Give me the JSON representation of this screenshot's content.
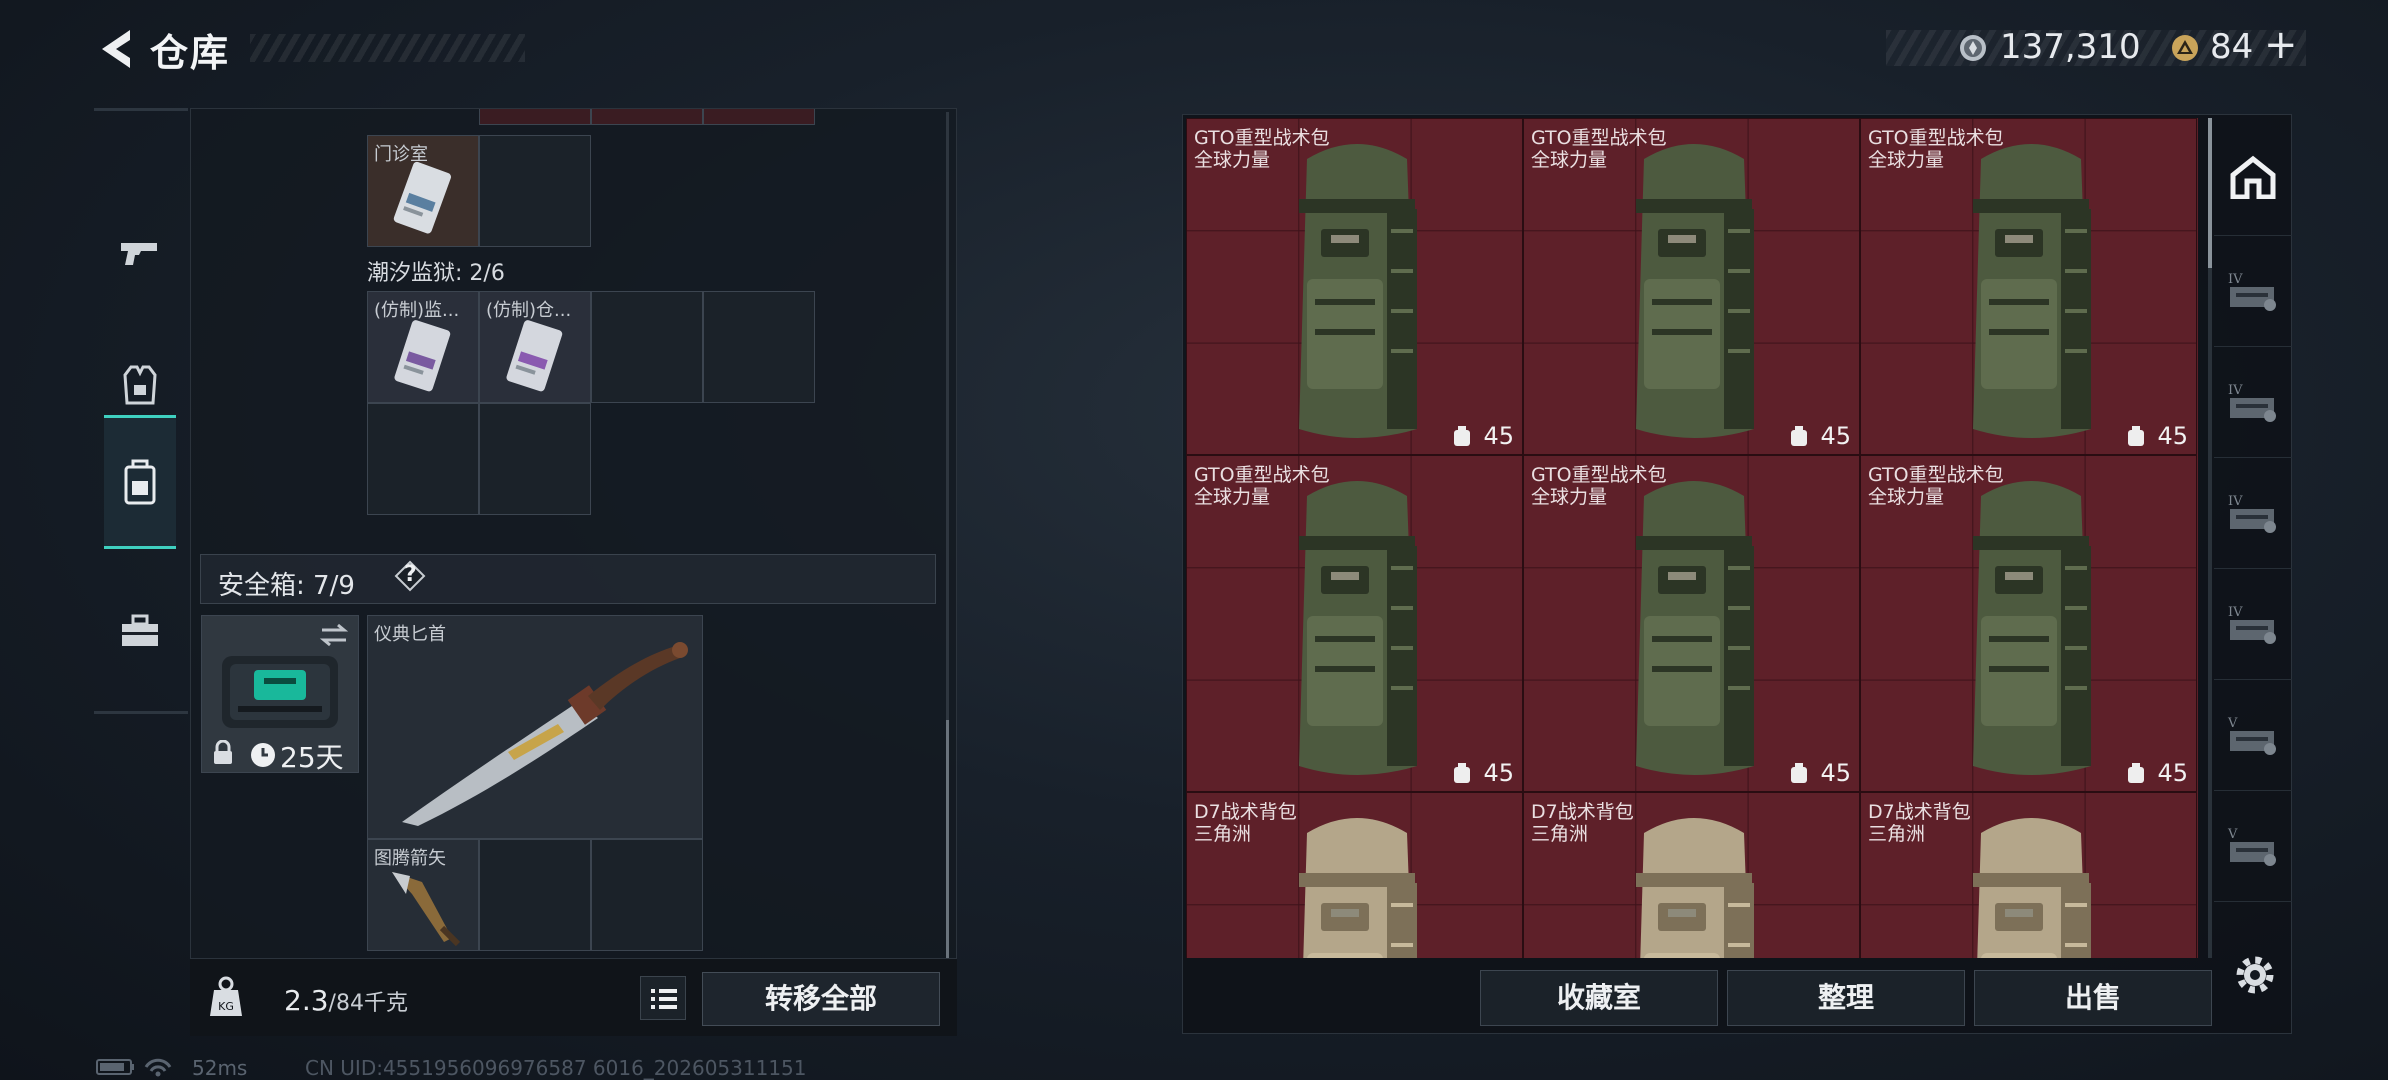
{
  "header": {
    "title": "仓库",
    "currency": {
      "coins": "137,310",
      "tickets": "84",
      "plus": "+"
    }
  },
  "left_sidebar": {
    "tabs": [
      {
        "icon": "pistol-icon",
        "active": false
      },
      {
        "icon": "vest-icon",
        "active": false
      },
      {
        "icon": "backpack-icon",
        "active": true
      },
      {
        "icon": "toolbox-icon",
        "active": false
      }
    ]
  },
  "left_panel": {
    "top_item_label": "门诊室",
    "section_prison": "潮汐监狱: 2/6",
    "prison_items": [
      "(仿制)监...",
      "(仿制)仓..."
    ],
    "safe_box": {
      "label": "安全箱: 7/9",
      "help": "?",
      "timer": "25天",
      "items": [
        {
          "label": "仪典匕首"
        },
        {
          "label": "图腾箭矢"
        }
      ]
    },
    "weight": {
      "current": "2.3",
      "max_unit": "/84千克"
    },
    "transfer_all": "转移全部"
  },
  "storage": {
    "slots": [
      {
        "name": "GTO重型战术包",
        "sub": "全球力量",
        "count": "45",
        "color": "green"
      },
      {
        "name": "GTO重型战术包",
        "sub": "全球力量",
        "count": "45",
        "color": "green"
      },
      {
        "name": "GTO重型战术包",
        "sub": "全球力量",
        "count": "45",
        "color": "green"
      },
      {
        "name": "GTO重型战术包",
        "sub": "全球力量",
        "count": "45",
        "color": "green"
      },
      {
        "name": "GTO重型战术包",
        "sub": "全球力量",
        "count": "45",
        "color": "green"
      },
      {
        "name": "GTO重型战术包",
        "sub": "全球力量",
        "count": "45",
        "color": "green"
      },
      {
        "name": "D7战术背包",
        "sub": "三角洲",
        "count": "",
        "color": "tan"
      },
      {
        "name": "D7战术背包",
        "sub": "三角洲",
        "count": "",
        "color": "tan"
      },
      {
        "name": "D7战术背包",
        "sub": "三角洲",
        "count": "",
        "color": "tan"
      }
    ],
    "right_tabs": [
      "home-icon",
      "IV",
      "IV",
      "IV",
      "IV",
      "V",
      "V"
    ]
  },
  "actions": {
    "collection": "收藏室",
    "sort": "整理",
    "sell": "出售"
  },
  "footer": {
    "ping": "52ms",
    "uid": "CN UID:4551956096976587 6016_202605311151"
  }
}
